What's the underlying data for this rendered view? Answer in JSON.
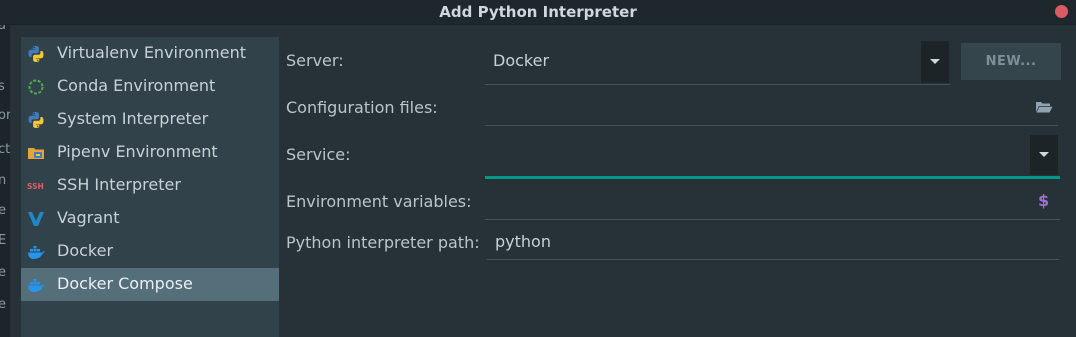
{
  "window": {
    "title": "Add Python Interpreter"
  },
  "left_strip": {
    "fragments": [
      "a",
      "s",
      "or",
      "ct",
      "n",
      "e",
      "E",
      "e",
      "e"
    ]
  },
  "sidebar": {
    "items": [
      {
        "label": "Virtualenv Environment",
        "icon": "python-icon"
      },
      {
        "label": "Conda Environment",
        "icon": "conda-icon"
      },
      {
        "label": "System Interpreter",
        "icon": "python-icon"
      },
      {
        "label": "Pipenv Environment",
        "icon": "pipenv-icon"
      },
      {
        "label": "SSH Interpreter",
        "icon": "ssh-icon",
        "icon_text": "SSH"
      },
      {
        "label": "Vagrant",
        "icon": "vagrant-icon"
      },
      {
        "label": "Docker",
        "icon": "docker-icon"
      },
      {
        "label": "Docker Compose",
        "icon": "docker-icon",
        "selected": true
      }
    ]
  },
  "form": {
    "server": {
      "label": "Server:",
      "value": "Docker",
      "new_button": "NEW..."
    },
    "config_files": {
      "label": "Configuration files:",
      "value": ""
    },
    "service": {
      "label": "Service:",
      "value": ""
    },
    "env_vars": {
      "label": "Environment variables:",
      "value": ""
    },
    "python_path": {
      "label": "Python interpreter path:",
      "value": "python"
    }
  },
  "colors": {
    "background": "#263238",
    "sidebar": "#32424a",
    "selected": "#546e7a",
    "accent": "#009688",
    "close": "#d85c64"
  }
}
